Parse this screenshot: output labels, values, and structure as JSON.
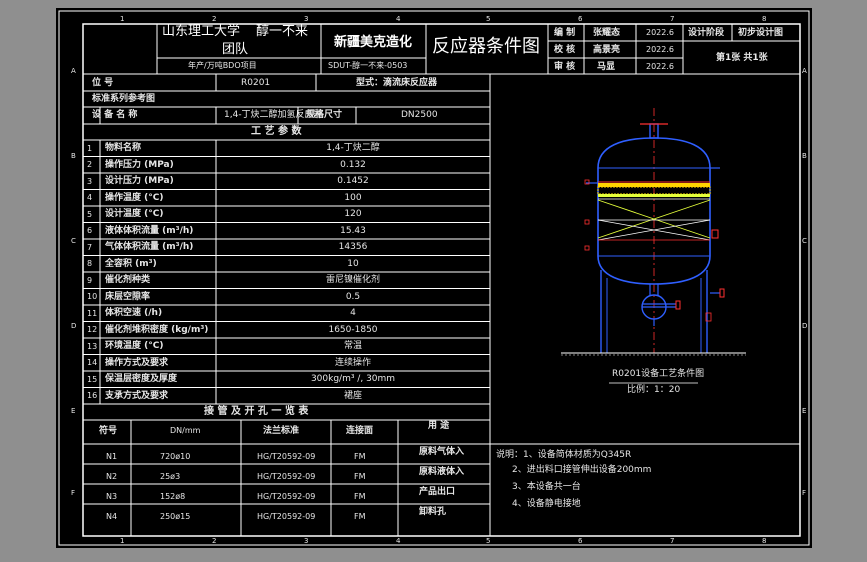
{
  "title_block": {
    "school": "山东理工大学",
    "group_line1": "醇一不来",
    "group_line2": "团队",
    "project": "年产/万吨BDO项目",
    "company": "新疆美克造化",
    "drawing_no": "SDUT-醇一不来-0503",
    "drawing_title": "反应器条件图",
    "roles": [
      {
        "role": "编 制",
        "name": "张耀态",
        "date": "2022.6"
      },
      {
        "role": "校 核",
        "name": "高景亮",
        "date": "2022.6"
      },
      {
        "role": "审 核",
        "name": "马显",
        "date": "2022.6"
      }
    ],
    "stage_label": "设计阶段",
    "stage_value": "初步设计图",
    "sheet_info": "第1张 共1张"
  },
  "header_rows": {
    "tag_label": "位 号",
    "tag_value": "R0201",
    "form_label": "型式：滴流床反应器",
    "ref_label": "标准系列参考图",
    "equip_label": "设 备 名 称",
    "equip_value": "1,4-丁炔二醇加氢反应器",
    "size_label": "规格尺寸",
    "size_value": "DN2500",
    "params_title": "工 艺 参 数"
  },
  "params": [
    {
      "no": "1",
      "name": "物料名称",
      "value": "1,4-丁炔二醇"
    },
    {
      "no": "2",
      "name": "操作压力 (MPa)",
      "value": "0.132"
    },
    {
      "no": "3",
      "name": "设计压力 (MPa)",
      "value": "0.1452"
    },
    {
      "no": "4",
      "name": "操作温度 (°C)",
      "value": "100"
    },
    {
      "no": "5",
      "name": "设计温度 (°C)",
      "value": "120"
    },
    {
      "no": "6",
      "name": "液体体积流量 (m³/h)",
      "value": "15.43"
    },
    {
      "no": "7",
      "name": "气体体积流量 (m³/h)",
      "value": "14356"
    },
    {
      "no": "8",
      "name": "全容积 (m³)",
      "value": "10"
    },
    {
      "no": "9",
      "name": "催化剂种类",
      "value": "雷尼镍催化剂"
    },
    {
      "no": "10",
      "name": "床层空隙率",
      "value": "0.5"
    },
    {
      "no": "11",
      "name": "体积空速 (/h)",
      "value": "4"
    },
    {
      "no": "12",
      "name": "催化剂堆积密度 (kg/m³)",
      "value": "1650-1850"
    },
    {
      "no": "13",
      "name": "环境温度 (°C)",
      "value": "常温"
    },
    {
      "no": "14",
      "name": "操作方式及要求",
      "value": "连续操作"
    },
    {
      "no": "15",
      "name": "保温层密度及厚度",
      "value": "300kg/m³ /, 30mm"
    },
    {
      "no": "16",
      "name": "支承方式及要求",
      "value": "裙座"
    }
  ],
  "nozzle_title": "接 管 及 开 孔 一 览 表",
  "nozzle_headers": [
    "符号",
    "DN/mm",
    "法兰标准",
    "连接面",
    "用 途"
  ],
  "nozzles": [
    {
      "sym": "N1",
      "dn": "720ø10",
      "std": "HG/T20592-09",
      "face": "FM",
      "use": "原料气体入"
    },
    {
      "sym": "N2",
      "dn": "25ø3",
      "std": "HG/T20592-09",
      "face": "FM",
      "use": "原料液体入"
    },
    {
      "sym": "N3",
      "dn": "152ø8",
      "std": "HG/T20592-09",
      "face": "FM",
      "use": "产品出口"
    },
    {
      "sym": "N4",
      "dn": "250ø15",
      "std": "HG/T20592-09",
      "face": "FM",
      "use": "卸料孔"
    }
  ],
  "vessel_caption": "R0201设备工艺条件图",
  "vessel_scale": "比例：1：20",
  "notes": [
    "说明：1、设备简体材质为Q345R",
    "2、进出料口接管伸出设备200mm",
    "3、本设备共一台",
    "4、设备静电接地"
  ],
  "frame_marks": {
    "top": [
      "1",
      "2",
      "3",
      "4",
      "5",
      "6",
      "7",
      "8"
    ],
    "side": [
      "A",
      "B",
      "C",
      "D",
      "E",
      "F"
    ]
  },
  "colors": {
    "background": "#8f8f8f",
    "sheet": "#000000",
    "line": "#ffffff",
    "vessel": "#2f5fff",
    "center_line": "#ff3030",
    "packing": "#ffd400",
    "catalyst": "#e5ff3a"
  }
}
